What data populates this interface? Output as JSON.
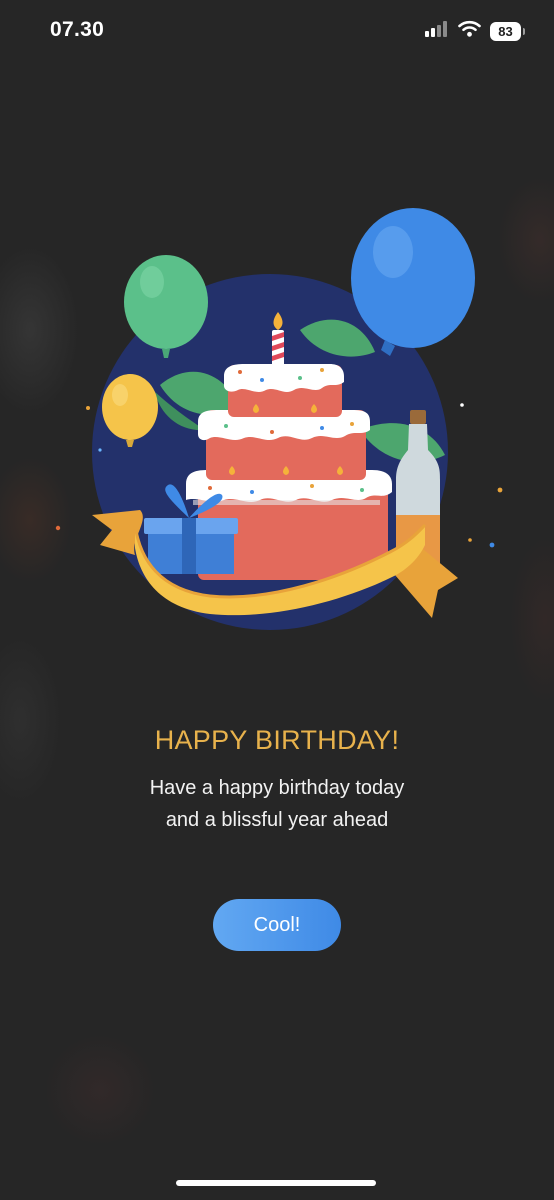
{
  "status_bar": {
    "time": "07.30",
    "battery_level": "83",
    "icons": [
      "signal-icon",
      "wifi-icon",
      "battery-icon"
    ]
  },
  "illustration": {
    "icon": "birthday-cake-illustration"
  },
  "content": {
    "title": "HAPPY BIRTHDAY!",
    "message_line_1": "Have a happy birthday today",
    "message_line_2": "and a blissful year ahead"
  },
  "actions": {
    "confirm_label": "Cool!"
  },
  "colors": {
    "background": "#262626",
    "title": "#e8b24c",
    "button": "#4a95ea",
    "text": "#f2f2f2"
  }
}
